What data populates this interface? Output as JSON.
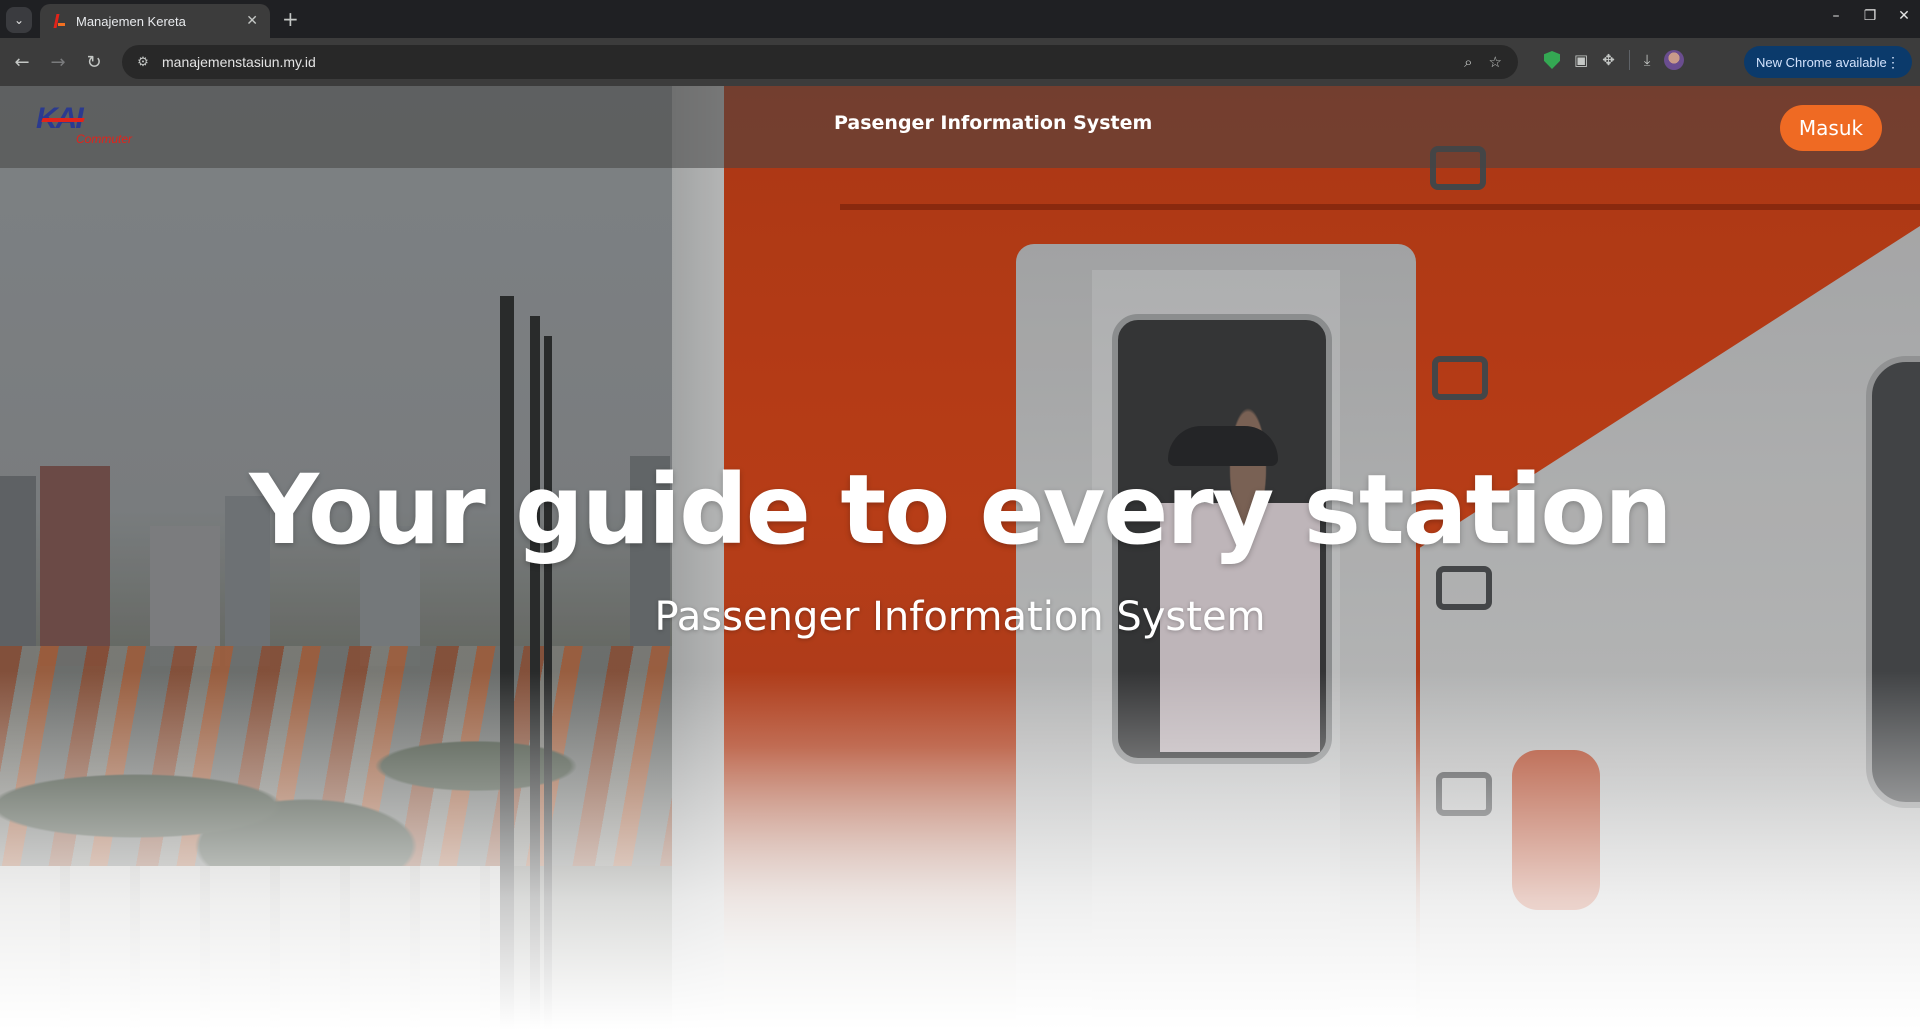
{
  "browser": {
    "tab_title": "Manajemen Kereta",
    "tab_close": "✕",
    "new_tab": "+",
    "url": "manajemenstasiun.my.id",
    "update_label": "New Chrome available",
    "icons": [
      "tab-search-icon",
      "back-icon",
      "forward-icon",
      "reload-icon",
      "site-info-icon",
      "zoom-icon",
      "bookmark-star-icon",
      "extension-shield-icon",
      "extension-window-icon",
      "extensions-puzzle-icon",
      "download-icon",
      "profile-avatar",
      "menu-dots-icon"
    ]
  },
  "site": {
    "logo_primary": "KAI",
    "logo_secondary": "Commuter",
    "nav_title": "Pasenger Information System",
    "login_label": "Masuk",
    "hero_title": "Your guide to every station",
    "hero_subtitle": "Passenger Information System"
  },
  "colors": {
    "accent": "#ef6a23",
    "logo_blue": "#2b3a8f",
    "logo_red": "#e2231a",
    "nav_overlay": "rgba(70,70,70,0.55)"
  }
}
